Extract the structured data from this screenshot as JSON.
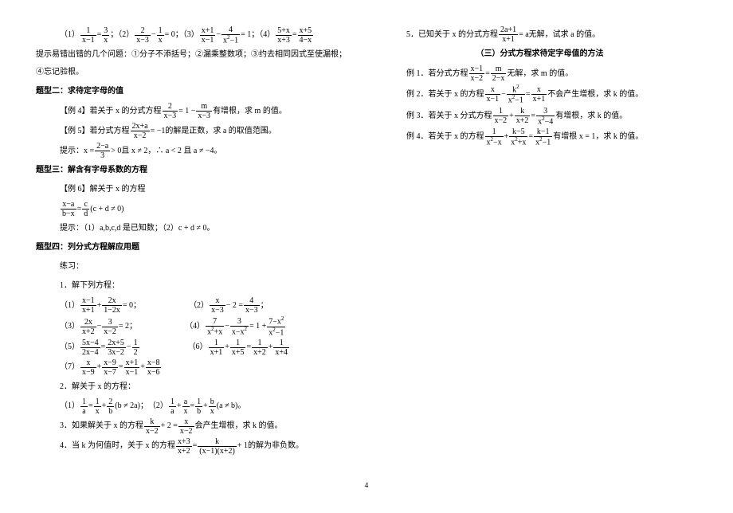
{
  "left": {
    "eq1_label": "（1）",
    "eq2_label": "；（2）",
    "eq3_label": "；（3）",
    "eq4_label": "；（4）",
    "hints": "提示易错出错的几个问题：①分子不添括号；②漏乘整数项；③约去相同因式至使漏根；④忘记验根。",
    "type2_title": "题型二：求待定字母的值",
    "ex4": "【例 4】若关于 x 的分式方程",
    "ex4_tail": "有增根，求 m 的值。",
    "ex5": "【例 5】若分式方程",
    "ex5_tail": "的解是正数，求 a 的取值范围。",
    "ex5_hint_pre": "提示：",
    "ex5_hint_mid1": " 且 x ≠ 2，∴ a < 2 且 a ≠ −4。",
    "type3_title": "题型三：解含有字母系数的方程",
    "ex6": "【例 6】解关于 x 的方程",
    "ex6_cond": "(c + d ≠ 0)",
    "ex6_hint": "提示：（1）a,b,c,d 是已知数；（2）c + d ≠ 0。",
    "type4_title": "题型四：列分式方程解应用题",
    "practice": "练习：",
    "p1": "1．解下列方程：",
    "p1_1": "（1）",
    "p1_2": "（2）",
    "p1_3": "（3）",
    "p1_4": "（4）",
    "p1_5": "（5）",
    "p1_6": "（6）",
    "p1_7": "（7）",
    "p2": "2．解关于 x 的方程：",
    "p2_1": "（1）",
    "p2_1_cond": "(b ≠ 2a)；",
    "p2_2": "（2）",
    "p2_2_cond": "(a ≠ b)。",
    "p3_pre": "3．如果解关于 x 的方程",
    "p3_post": "会产生增根，求 k 的值。",
    "p4_pre": "4．当 k 为何值时，关于 x 的方程",
    "p4_post": "的解为非负数。"
  },
  "right": {
    "p5_pre": "5．已知关于 x 的分式方程",
    "p5_post": "无解，试求 a 的值。",
    "section3_title": "（三）分式方程求待定字母值的方法",
    "r1_pre": "例 1．若分式方程",
    "r1_post": "无解，求 m 的值。",
    "r2_pre": "例 2．若关于 x 的方程",
    "r2_post": "不会产生增根，求 k 的值。",
    "r3_pre": "例 3．若关于 x 分式方程",
    "r3_post": "有增根，求 k 的值。",
    "r4_pre": "例 4．若关于 x 的方程",
    "r4_post": "有增根 x = 1，求 k 的值。"
  },
  "pagenum": "4"
}
